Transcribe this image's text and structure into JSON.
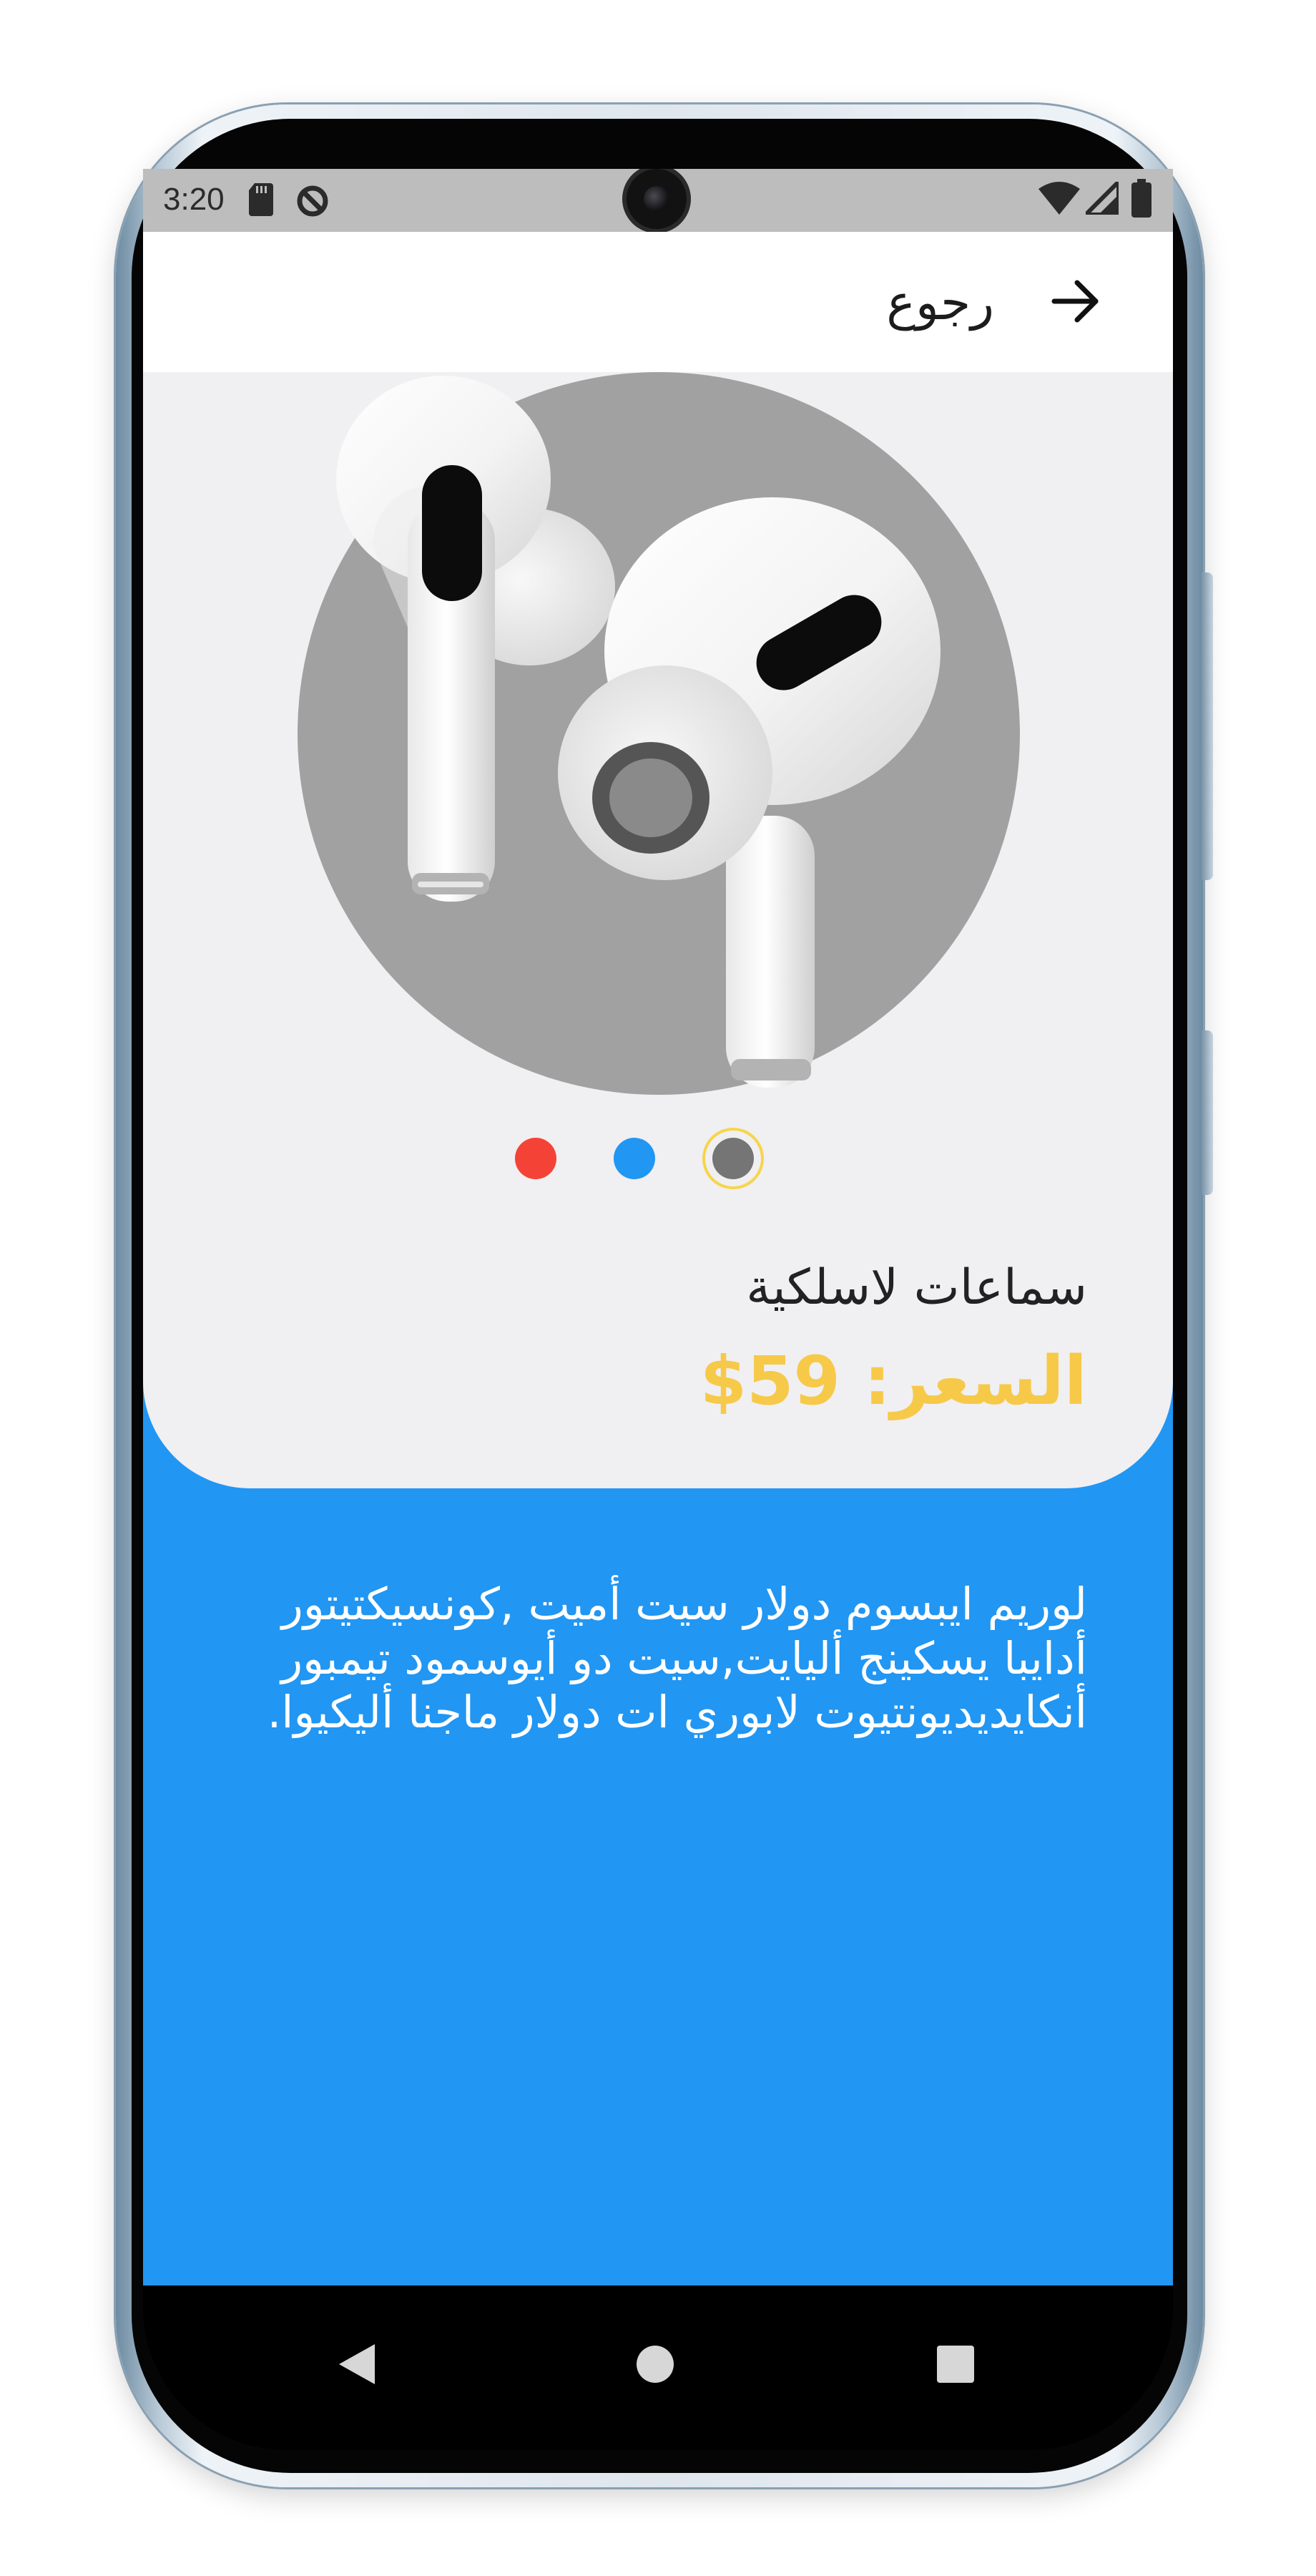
{
  "status_bar": {
    "time": "3:20",
    "left_icons": [
      "sd-card-icon",
      "sync-icon"
    ],
    "right_icons": [
      "wifi-icon",
      "signal-icon",
      "battery-icon"
    ]
  },
  "app_bar": {
    "back_label": "رجوع",
    "back_icon": "arrow-right-icon"
  },
  "product": {
    "image": "airpods-pro-product-image",
    "colors": [
      {
        "name": "red",
        "hex": "#f44336",
        "selected": false
      },
      {
        "name": "blue",
        "hex": "#2196f3",
        "selected": false
      },
      {
        "name": "gray",
        "hex": "#757575",
        "selected": true
      }
    ],
    "name": "سماعات لاسلكية",
    "price": "السعر: 59$",
    "description": "لوريم ايبسوم دولار سيت أميت ,كونسيكتيتور أدايبا يسكينج أليايت,سيت دو أيوسمود تيمبور أنكايديديونتيوت لابوري ات دولار ماجنا أليكيوا."
  },
  "navigation": {
    "back_icon": "triangle-back-icon",
    "home_icon": "circle-home-icon",
    "recents_icon": "square-recents-icon"
  },
  "theme": {
    "accent": "#2196f3",
    "price_color": "#f7c948",
    "panel_bg": "#f0eff2",
    "circle_bg": "#a1a1a1"
  }
}
